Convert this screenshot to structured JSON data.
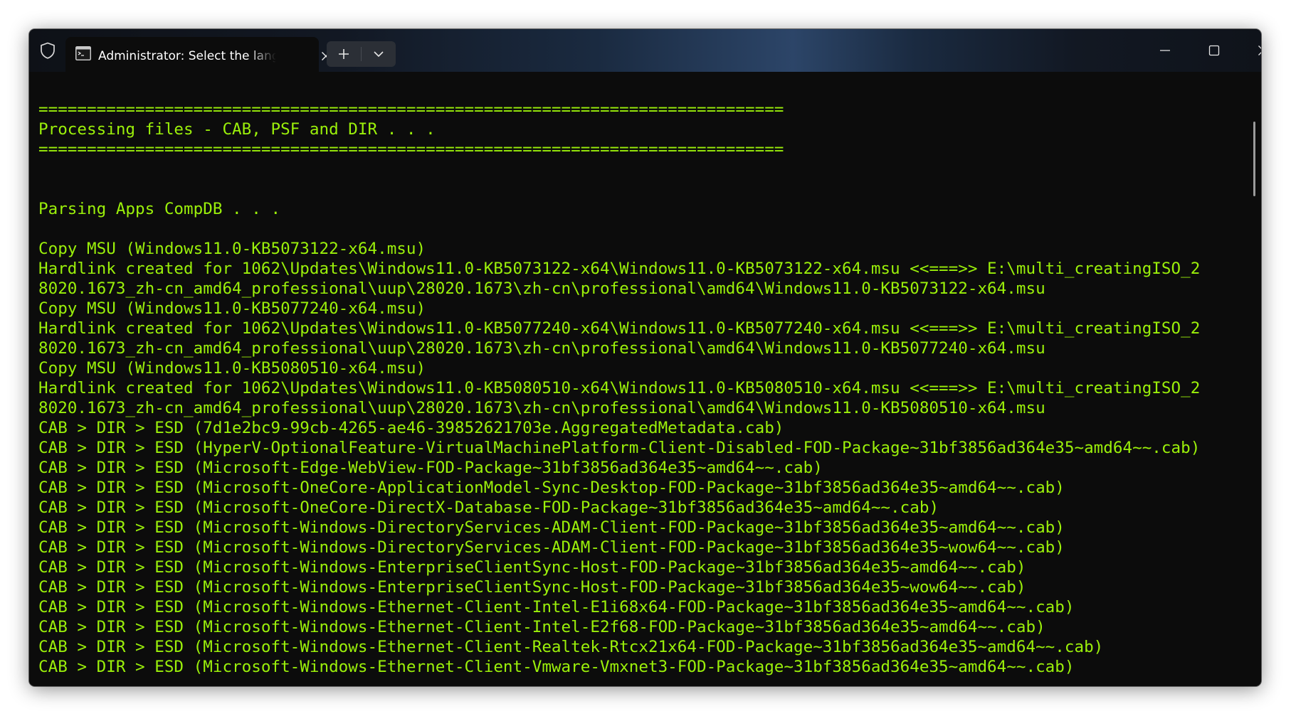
{
  "window": {
    "tab_title": "Administrator:  Select the lang",
    "icons": {
      "shield": "shield-icon",
      "tab": "terminal-icon",
      "tab_close": "close-icon",
      "new_tab": "plus-icon",
      "dropdown": "chevron-down-icon",
      "minimize": "minimize-icon",
      "maximize": "maximize-icon",
      "close": "close-icon"
    }
  },
  "terminal": {
    "text_color": "#9bf00a",
    "background": "#0c0c0c",
    "lines": [
      "=============================================================================",
      "Processing files - CAB, PSF and DIR . . .",
      "=============================================================================",
      "",
      "",
      "Parsing Apps CompDB . . .",
      "",
      "Copy MSU (Windows11.0-KB5073122-x64.msu)",
      "Hardlink created for 1062\\Updates\\Windows11.0-KB5073122-x64\\Windows11.0-KB5073122-x64.msu <<===>> E:\\multi_creatingISO_2",
      "8020.1673_zh-cn_amd64_professional\\uup\\28020.1673\\zh-cn\\professional\\amd64\\Windows11.0-KB5073122-x64.msu",
      "Copy MSU (Windows11.0-KB5077240-x64.msu)",
      "Hardlink created for 1062\\Updates\\Windows11.0-KB5077240-x64\\Windows11.0-KB5077240-x64.msu <<===>> E:\\multi_creatingISO_2",
      "8020.1673_zh-cn_amd64_professional\\uup\\28020.1673\\zh-cn\\professional\\amd64\\Windows11.0-KB5077240-x64.msu",
      "Copy MSU (Windows11.0-KB5080510-x64.msu)",
      "Hardlink created for 1062\\Updates\\Windows11.0-KB5080510-x64\\Windows11.0-KB5080510-x64.msu <<===>> E:\\multi_creatingISO_2",
      "8020.1673_zh-cn_amd64_professional\\uup\\28020.1673\\zh-cn\\professional\\amd64\\Windows11.0-KB5080510-x64.msu",
      "CAB > DIR > ESD (7d1e2bc9-99cb-4265-ae46-39852621703e.AggregatedMetadata.cab)",
      "CAB > DIR > ESD (HyperV-OptionalFeature-VirtualMachinePlatform-Client-Disabled-FOD-Package~31bf3856ad364e35~amd64~~.cab)",
      "CAB > DIR > ESD (Microsoft-Edge-WebView-FOD-Package~31bf3856ad364e35~amd64~~.cab)",
      "CAB > DIR > ESD (Microsoft-OneCore-ApplicationModel-Sync-Desktop-FOD-Package~31bf3856ad364e35~amd64~~.cab)",
      "CAB > DIR > ESD (Microsoft-OneCore-DirectX-Database-FOD-Package~31bf3856ad364e35~amd64~~.cab)",
      "CAB > DIR > ESD (Microsoft-Windows-DirectoryServices-ADAM-Client-FOD-Package~31bf3856ad364e35~amd64~~.cab)",
      "CAB > DIR > ESD (Microsoft-Windows-DirectoryServices-ADAM-Client-FOD-Package~31bf3856ad364e35~wow64~~.cab)",
      "CAB > DIR > ESD (Microsoft-Windows-EnterpriseClientSync-Host-FOD-Package~31bf3856ad364e35~amd64~~.cab)",
      "CAB > DIR > ESD (Microsoft-Windows-EnterpriseClientSync-Host-FOD-Package~31bf3856ad364e35~wow64~~.cab)",
      "CAB > DIR > ESD (Microsoft-Windows-Ethernet-Client-Intel-E1i68x64-FOD-Package~31bf3856ad364e35~amd64~~.cab)",
      "CAB > DIR > ESD (Microsoft-Windows-Ethernet-Client-Intel-E2f68-FOD-Package~31bf3856ad364e35~amd64~~.cab)",
      "CAB > DIR > ESD (Microsoft-Windows-Ethernet-Client-Realtek-Rtcx21x64-FOD-Package~31bf3856ad364e35~amd64~~.cab)",
      "CAB > DIR > ESD (Microsoft-Windows-Ethernet-Client-Vmware-Vmxnet3-FOD-Package~31bf3856ad364e35~amd64~~.cab)"
    ]
  }
}
